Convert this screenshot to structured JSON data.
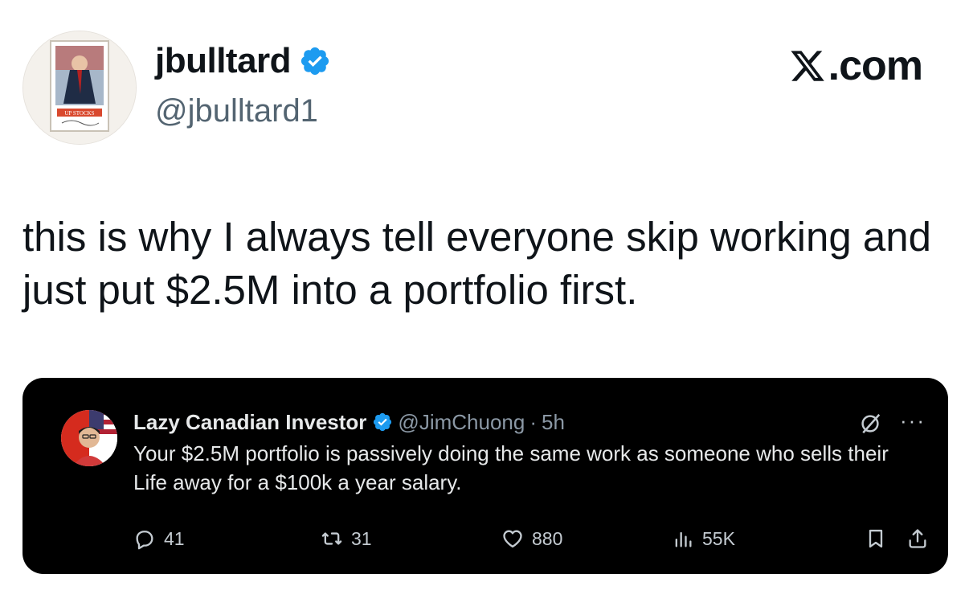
{
  "author": {
    "display_name": "jbulltard",
    "handle": "@jbulltard1",
    "verified_icon": "verified-badge-icon",
    "avatar_caption": "UP STOCKS"
  },
  "brand": {
    "label": ".com",
    "icon": "x-logo-icon"
  },
  "tweet": {
    "text": "this is why I always tell everyone skip working and just put $2.5M into a portfolio first."
  },
  "quoted": {
    "display_name": "Lazy Canadian Investor",
    "handle": "@JimChuong",
    "separator": "·",
    "time": "5h",
    "text": "Your $2.5M portfolio is passively doing the same work as someone who sells their Life away for a $100k a year salary.",
    "more": "···",
    "stats": {
      "replies": "41",
      "reposts": "31",
      "likes": "880",
      "views": "55K"
    }
  },
  "colors": {
    "verified": "#1d9bf0",
    "quote_bg": "#000000",
    "muted_text": "#536471"
  }
}
